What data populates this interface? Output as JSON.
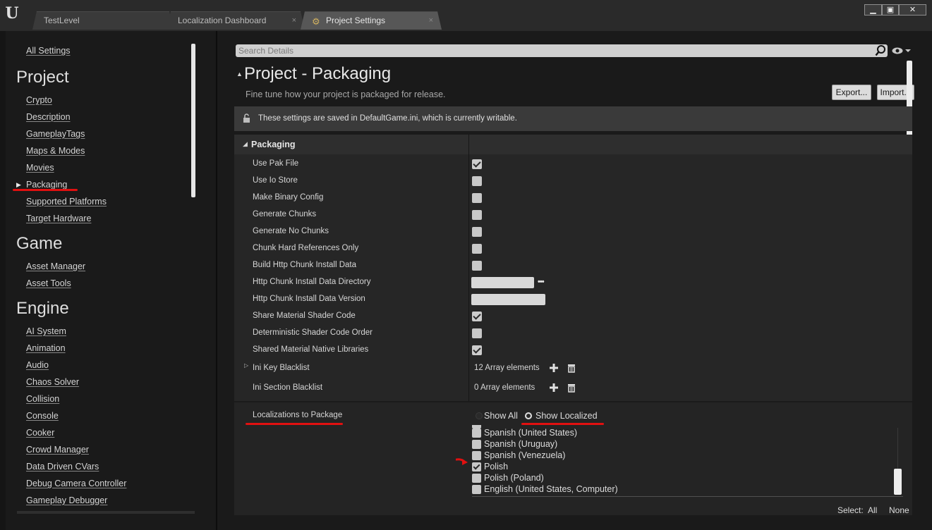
{
  "window": {
    "tabs": [
      {
        "label": "TestLevel"
      },
      {
        "label": "Localization Dashboard",
        "close": "×"
      },
      {
        "label": "Project Settings",
        "close": "×"
      }
    ],
    "controls": {
      "minimize": "▬",
      "maximize": "▣",
      "close": "✕"
    },
    "logo": "U"
  },
  "sidebar": {
    "all_settings": "All Settings",
    "sections": [
      {
        "title": "Project",
        "items": [
          "Crypto",
          "Description",
          "GameplayTags",
          "Maps & Modes",
          "Movies",
          "Packaging",
          "Supported Platforms",
          "Target Hardware"
        ]
      },
      {
        "title": "Game",
        "items": [
          "Asset Manager",
          "Asset Tools"
        ]
      },
      {
        "title": "Engine",
        "items": [
          "AI System",
          "Animation",
          "Audio",
          "Chaos Solver",
          "Collision",
          "Console",
          "Cooker",
          "Crowd Manager",
          "Data Driven CVars",
          "Debug Camera Controller",
          "Gameplay Debugger"
        ]
      }
    ],
    "selected": "Packaging"
  },
  "details": {
    "search_placeholder": "Search Details",
    "title": "Project - Packaging",
    "subtitle": "Fine tune how your project is packaged for release.",
    "export_label": "Export...",
    "import_label": "Import...",
    "info_text": "These settings are saved in DefaultGame.ini, which is currently writable.",
    "category": "Packaging",
    "properties": [
      {
        "label": "Use Pak File",
        "type": "checkbox",
        "checked": true
      },
      {
        "label": "Use Io Store",
        "type": "checkbox",
        "checked": false
      },
      {
        "label": "Make Binary Config",
        "type": "checkbox",
        "checked": false
      },
      {
        "label": "Generate Chunks",
        "type": "checkbox",
        "checked": false
      },
      {
        "label": "Generate No Chunks",
        "type": "checkbox",
        "checked": false
      },
      {
        "label": "Chunk Hard References Only",
        "type": "checkbox",
        "checked": false
      },
      {
        "label": "Build Http Chunk Install Data",
        "type": "checkbox",
        "checked": false
      },
      {
        "label": "Http Chunk Install Data Directory",
        "type": "path",
        "value": ""
      },
      {
        "label": "Http Chunk Install Data Version",
        "type": "text",
        "value": ""
      },
      {
        "label": "Share Material Shader Code",
        "type": "checkbox",
        "checked": true
      },
      {
        "label": "Deterministic Shader Code Order",
        "type": "checkbox",
        "checked": false
      },
      {
        "label": "Shared Material Native Libraries",
        "type": "checkbox",
        "checked": true
      },
      {
        "label": "Ini Key Blacklist",
        "type": "array",
        "count": "12 Array elements"
      },
      {
        "label": "Ini Section Blacklist",
        "type": "array",
        "count": "0 Array elements"
      }
    ],
    "localizations": {
      "label": "Localizations to Package",
      "show_all": "Show All",
      "show_localized": "Show Localized",
      "selected_filter": "Show Localized",
      "languages": [
        {
          "name": "Spanish (United States)",
          "checked": false
        },
        {
          "name": "Spanish (Uruguay)",
          "checked": false
        },
        {
          "name": "Spanish (Venezuela)",
          "checked": false
        },
        {
          "name": "Polish",
          "checked": true
        },
        {
          "name": "Polish (Poland)",
          "checked": false
        },
        {
          "name": "English (United States, Computer)",
          "checked": false
        }
      ],
      "select_label": "Select:",
      "select_all": "All",
      "select_none": "None"
    }
  },
  "colors": {
    "annotation_red": "#e11010",
    "panel_bg": "#1a1a1a",
    "details_bg": "#262626"
  }
}
